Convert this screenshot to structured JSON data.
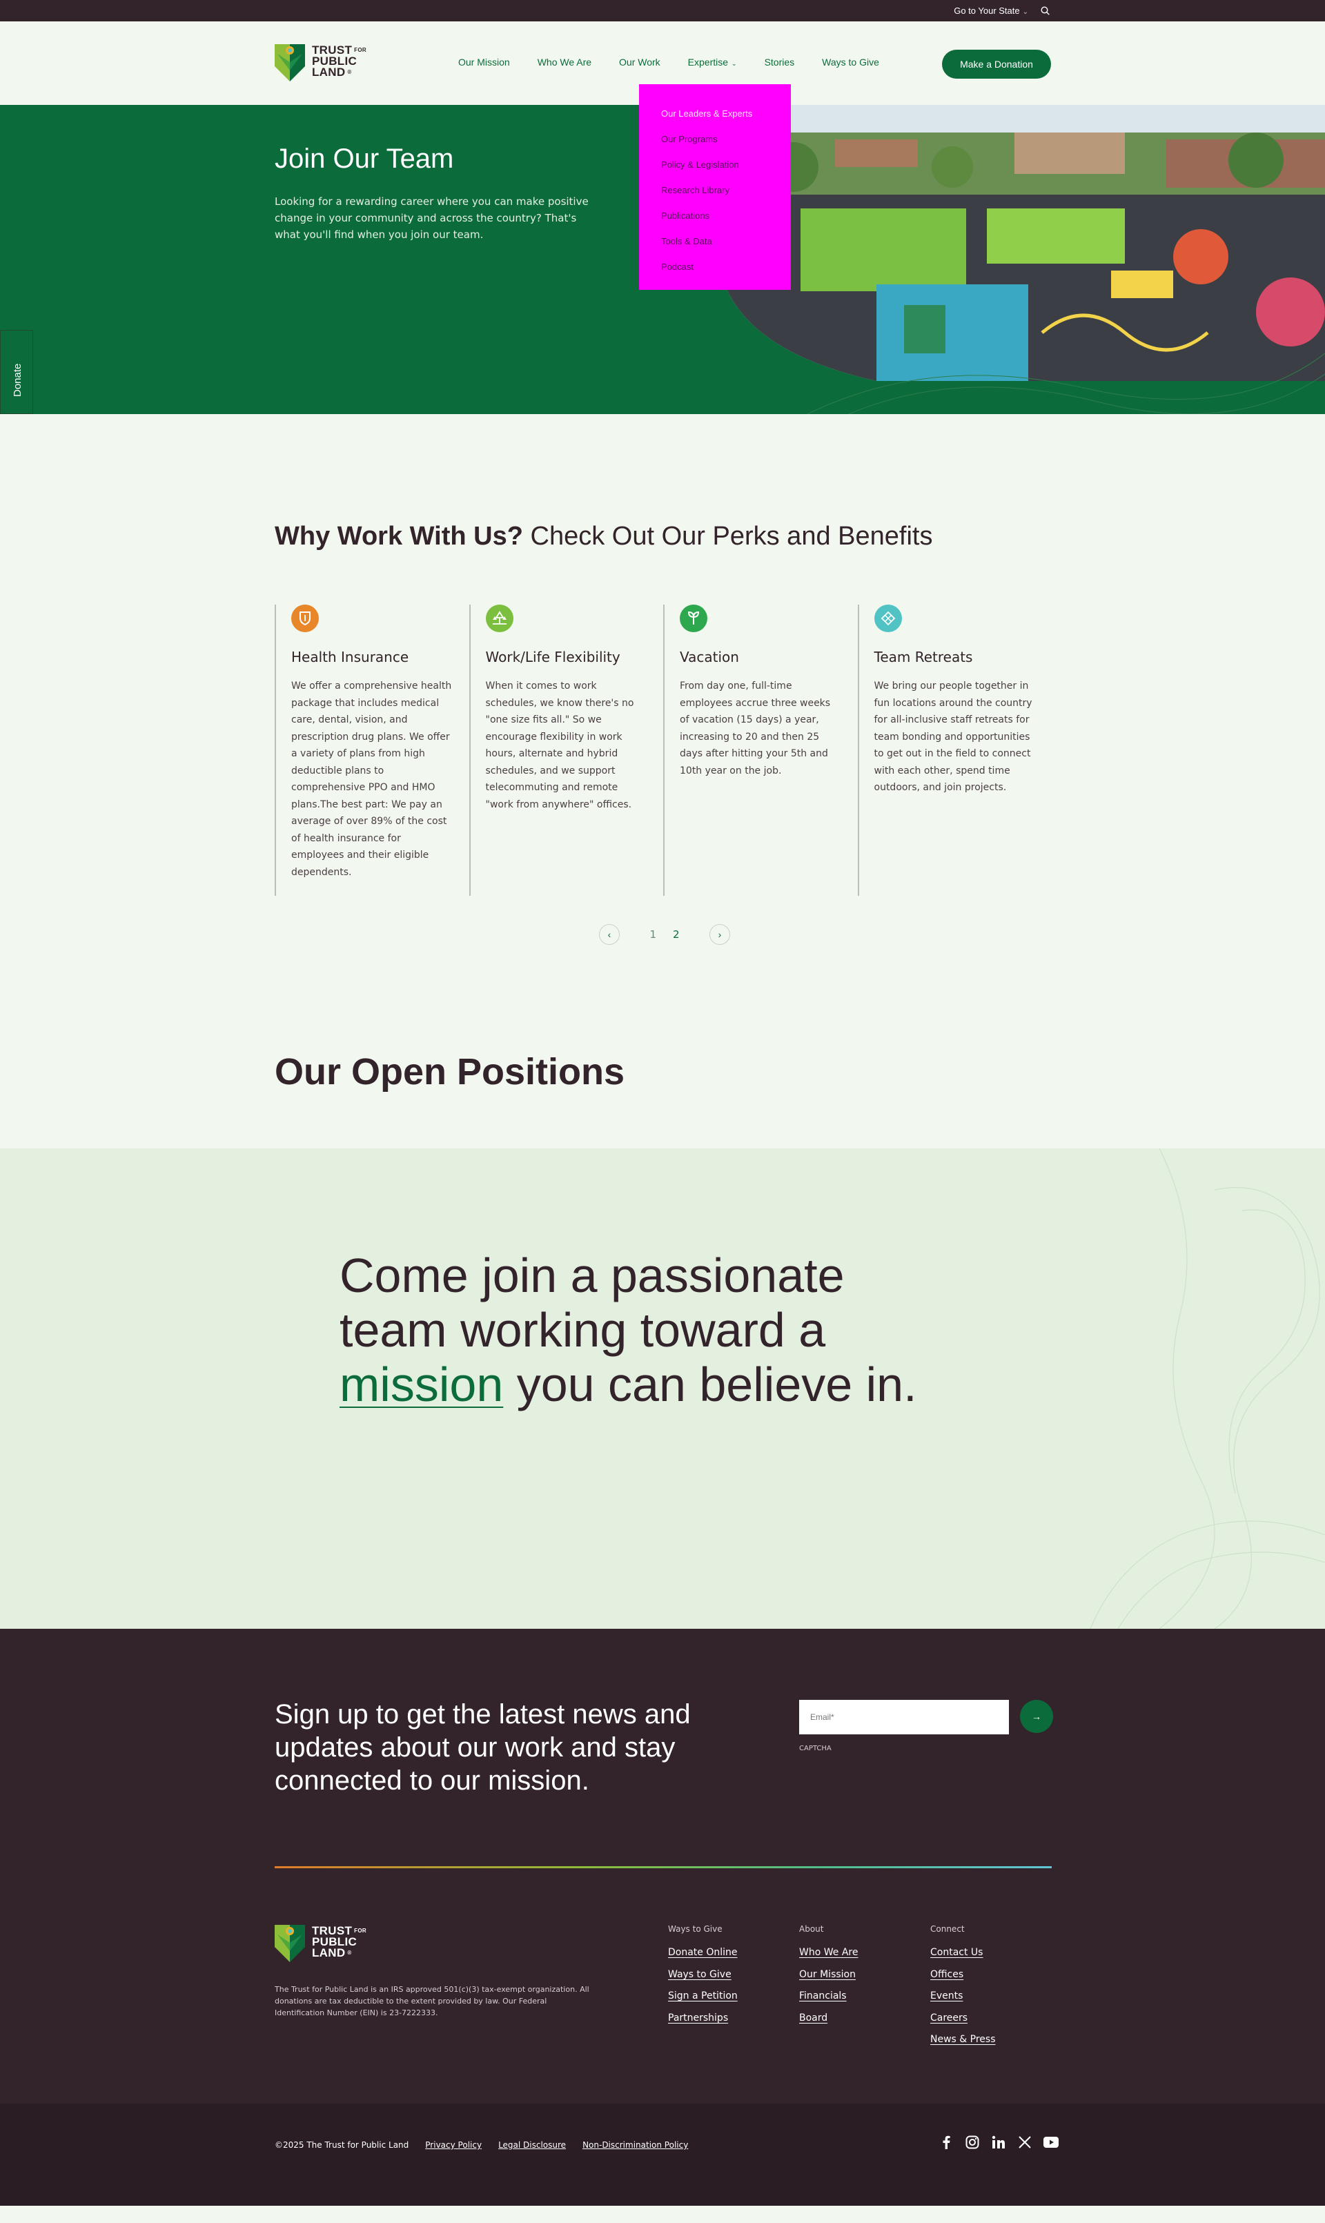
{
  "topbar": {
    "state_label": "Go to Your State"
  },
  "logo": {
    "line1": "TRUST",
    "for": "FOR",
    "line2": "PUBLIC",
    "line3": "LAND"
  },
  "nav": {
    "items": [
      "Our Mission",
      "Who We Are",
      "Our Work",
      "Expertise",
      "Stories",
      "Ways to Give"
    ],
    "donate_label": "Make a Donation"
  },
  "dropdown": {
    "items": [
      "Our Leaders & Experts",
      "Our Programs",
      "Policy & Legislation",
      "Research Library",
      "Publications",
      "Tools & Data",
      "Podcast"
    ]
  },
  "side_donate": {
    "label": "Donate"
  },
  "hero": {
    "title": "Join Our Team",
    "body": "Looking for a rewarding career where you can make positive change in your community and across the country? That's what you'll find when you join our team."
  },
  "perks": {
    "title_bold": "Why Work With Us?",
    "title_rest": " Check Out Our Perks and Benefits",
    "items": [
      {
        "title": "Health Insurance",
        "body": "We offer a comprehensive health package that includes medical care, dental, vision, and prescription drug plans. We offer a variety of plans from high deductible plans to comprehensive PPO and HMO plans.The best part: We pay an average of over 89% of the cost of health insurance for employees and their eligible dependents.",
        "icon": "shield-icon",
        "color": "#e8872a"
      },
      {
        "title": "Work/Life Flexibility",
        "body": "When it comes to work schedules, we know there's no \"one size fits all.\" So we encourage flexibility in work hours, alternate and hybrid schedules, and we support telecommuting and remote \"work from anywhere\" offices.",
        "icon": "trees-icon",
        "color": "#7cbf3f"
      },
      {
        "title": "Vacation",
        "body": "From day one, full-time employees accrue three weeks of vacation (15 days) a year, increasing to 20 and then 25 days after hitting your 5th and 10th year on the job.",
        "icon": "sprout-icon",
        "color": "#2ea84f"
      },
      {
        "title": "Team Retreats",
        "body": "We bring our people together in fun locations around the country for all-inclusive staff retreats for team bonding and opportunities to get out in the field to connect with each other, spend time outdoors, and join projects.",
        "icon": "pattern-icon",
        "color": "#52c3c5"
      }
    ],
    "pages": [
      "1",
      "2"
    ]
  },
  "positions": {
    "title": "Our Open Positions"
  },
  "mission": {
    "line_a": "Come join a passionate team working toward a ",
    "highlight": "mission",
    "line_b": " you can believe in."
  },
  "footer": {
    "signup": "Sign up to get the latest news and updates about our work and stay connected to our mission.",
    "email_placeholder": "Email*",
    "captcha": "CAPTCHA",
    "legal": "The Trust for Public Land is an IRS approved 501(c)(3) tax-exempt organization. All donations are tax deductible to the extent provided by law. Our Federal Identification Number (EIN) is 23-7222333.",
    "cols": [
      {
        "heading": "Ways to Give",
        "links": [
          "Donate Online",
          "Ways to Give",
          "Sign a Petition",
          "Partnerships"
        ]
      },
      {
        "heading": "About",
        "links": [
          "Who We Are",
          "Our Mission",
          "Financials",
          "Board"
        ]
      },
      {
        "heading": "Connect",
        "links": [
          "Contact Us",
          "Offices",
          "Events",
          "Careers",
          "News & Press"
        ]
      }
    ],
    "copyright": "©2025 The Trust for Public Land",
    "bottom_links": [
      "Privacy Policy",
      "Legal Disclosure",
      "Non-Discrimination Policy"
    ],
    "social": [
      "facebook-icon",
      "instagram-icon",
      "linkedin-icon",
      "x-icon",
      "youtube-icon"
    ]
  },
  "colors": {
    "brand_green": "#0b6b3a",
    "dark": "#33232a",
    "light_bg": "#f2f8ef",
    "mint": "#e3efdf"
  }
}
